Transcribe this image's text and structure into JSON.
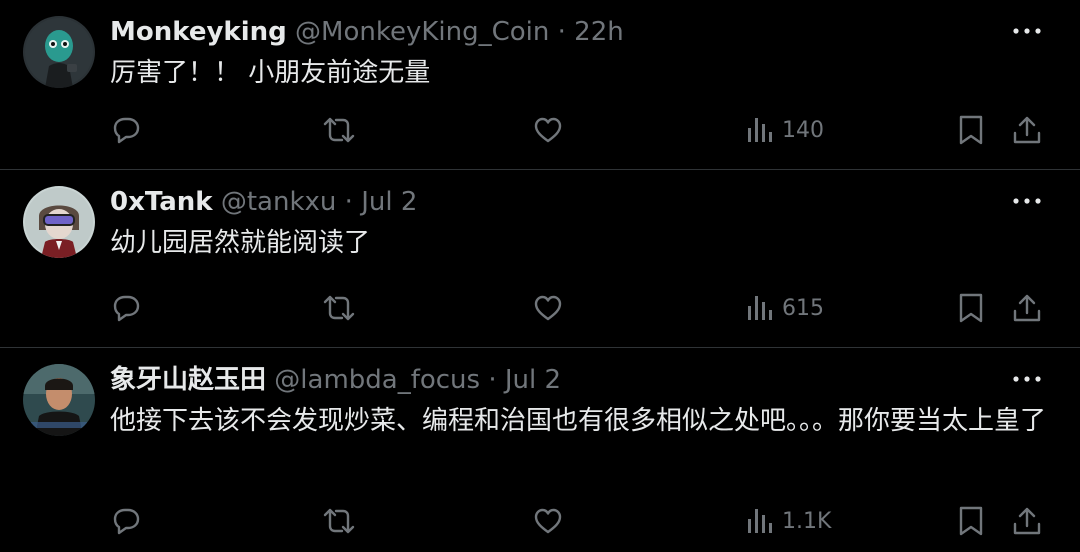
{
  "colors": {
    "background": "#000000",
    "primary_text": "#e7e9ea",
    "secondary_text": "#71767b",
    "divider": "#2f3336"
  },
  "tweets": [
    {
      "name": "Monkeyking",
      "handle": "@MonkeyKing_Coin",
      "separator": "·",
      "time": "22h",
      "text": "厉害了！！ 小朋友前途无量",
      "views": "140",
      "avatar_icon": "monkey-avatar"
    },
    {
      "name": "0xTank",
      "handle": "@tankxu",
      "separator": "·",
      "time": "Jul 2",
      "text": "幼儿园居然就能阅读了",
      "views": "615",
      "avatar_icon": "vr-headset-avatar"
    },
    {
      "name": "象牙山赵玉田",
      "handle": "@lambda_focus",
      "separator": "·",
      "time": "Jul 2",
      "text": "他接下去该不会发现炒菜、编程和治国也有很多相似之处吧。。。那你要当太上皇了",
      "views": "1.1K",
      "avatar_icon": "person-photo-avatar"
    }
  ],
  "action_icons": [
    "reply-icon",
    "retweet-icon",
    "like-icon",
    "views-icon",
    "bookmark-icon",
    "share-icon"
  ]
}
